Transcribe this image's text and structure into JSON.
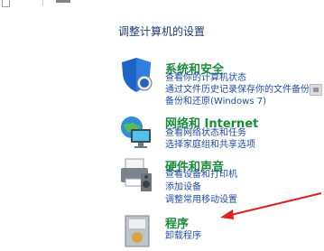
{
  "page": {
    "heading": "调整计算机的设置"
  },
  "categories": [
    {
      "title": "系统和安全",
      "icon": "shield-icon",
      "links": [
        "查看你的计算机状态",
        "通过文件历史记录保存你的文件备份",
        "备份和还原(Windows 7)"
      ]
    },
    {
      "title": "网络和 Internet",
      "icon": "network-globe-icon",
      "links": [
        "查看网络状态和任务",
        "选择家庭组和共享选项"
      ]
    },
    {
      "title": "硬件和声音",
      "icon": "printer-speaker-icon",
      "links": [
        "查看设备和打印机",
        "添加设备",
        "调整常用移动设置"
      ]
    },
    {
      "title": "程序",
      "icon": "programs-box-icon",
      "links": [
        "卸载程序"
      ]
    }
  ],
  "annotation": {
    "icon": "red-arrow-icon",
    "color": "#e02020"
  },
  "colors": {
    "category_title": "#1a8c3c",
    "link": "#1f4ea8",
    "heading": "#1f3a75"
  }
}
